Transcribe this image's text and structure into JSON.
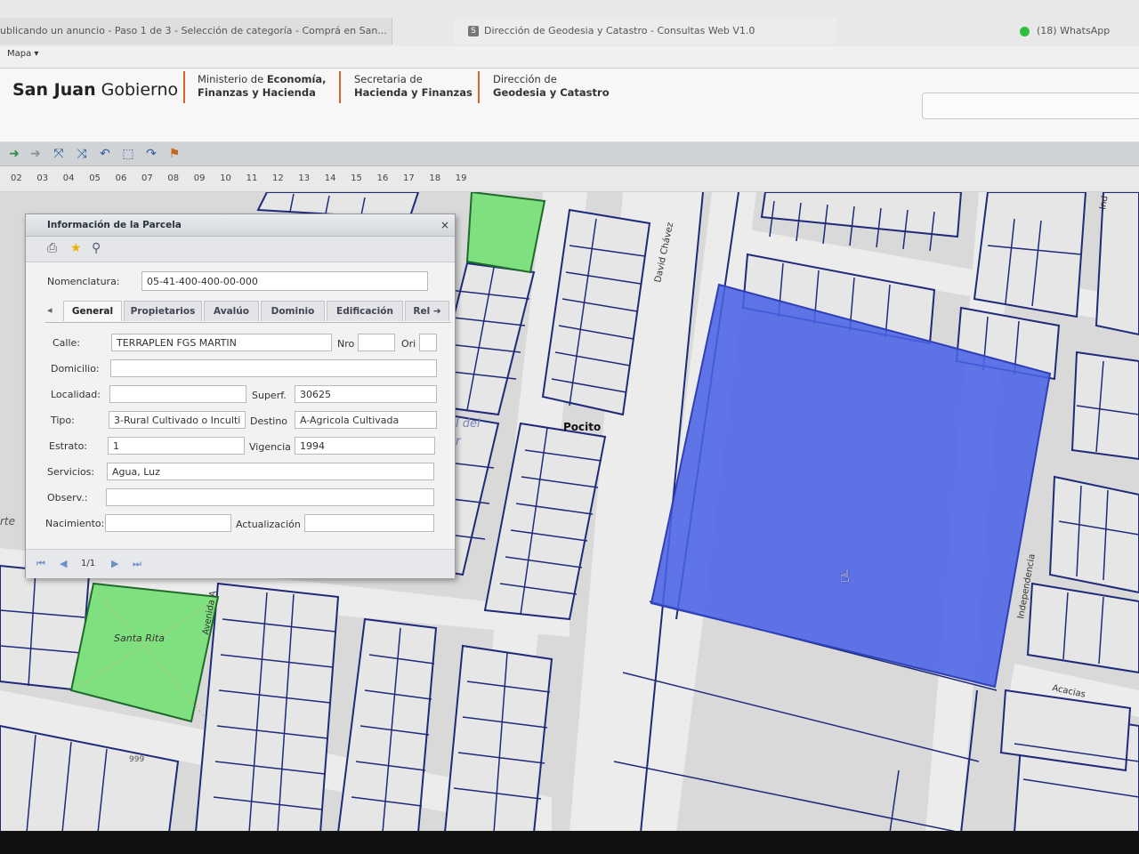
{
  "browser": {
    "tabs": [
      {
        "label": "ublicando un anuncio - Paso 1 de 3 - Selección de categoría - Comprá en San..."
      },
      {
        "label": "Dirección de Geodesia y Catastro - Consultas Web V1.0",
        "favicon": "S"
      },
      {
        "label": "(18) WhatsApp"
      }
    ]
  },
  "menu": {
    "mapa": "Mapa ▾"
  },
  "header": {
    "brand_bold": "San Juan",
    "brand_light": " Gobierno",
    "ministries": [
      {
        "line1_a": "Ministerio de ",
        "line1_b": "Economía,",
        "line2": "Finanzas y Hacienda"
      },
      {
        "line1_a": "Secretaria  de",
        "line1_b": "",
        "line2": "Hacienda y Finanzas"
      },
      {
        "line1_a": "Dirección de",
        "line1_b": "",
        "line2": "Geodesia y Catastro"
      }
    ]
  },
  "zoom_levels": [
    "02",
    "03",
    "04",
    "05",
    "06",
    "07",
    "08",
    "09",
    "10",
    "11",
    "12",
    "13",
    "14",
    "15",
    "16",
    "17",
    "18",
    "19"
  ],
  "map": {
    "labels": {
      "pocito": "Pocito",
      "santa_rita": "Santa Rita",
      "david_chavez": "David Chávez",
      "independencia": "Independencia",
      "acacias": "Acacias",
      "avenida": "Avenida A",
      "ind": "Ind",
      "num999": "999",
      "del": "l del",
      "r_mark": "r",
      "rte": "rte"
    },
    "colors": {
      "background": "#d9d9d9",
      "block_fill": "#e6e6e6",
      "lines": "#1f2a78",
      "selected_parcel": "#4b63e6",
      "park": "#7fe07f"
    }
  },
  "dialog": {
    "title": "Información de la Parcela",
    "close": "×",
    "nomenclatura_label": "Nomenclatura:",
    "nomenclatura_value": "05-41-400-400-00-000",
    "tabs": [
      {
        "label": "General",
        "active": true
      },
      {
        "label": "Propietarios"
      },
      {
        "label": "Avalúo"
      },
      {
        "label": "Dominio"
      },
      {
        "label": "Edificación"
      },
      {
        "label": "Rel ➔"
      }
    ],
    "fields": {
      "calle": {
        "label": "Calle:",
        "value": "TERRAPLEN FGS MARTIN"
      },
      "nro": {
        "label": "Nro",
        "value": ""
      },
      "ori": {
        "label": "Ori",
        "value": ""
      },
      "domicilio": {
        "label": "Domicilio:",
        "value": ""
      },
      "localidad": {
        "label": "Localidad:",
        "value": ""
      },
      "superf": {
        "label": "Superf.",
        "value": "30625"
      },
      "tipo": {
        "label": "Tipo:",
        "value": "3-Rural Cultivado o Inculti"
      },
      "destino": {
        "label": "Destino",
        "value": "A-Agricola Cultivada"
      },
      "estrato": {
        "label": "Estrato:",
        "value": "1"
      },
      "vigencia": {
        "label": "Vigencia",
        "value": "1994"
      },
      "servicios": {
        "label": "Servicios:",
        "value": "Agua, Luz"
      },
      "observ": {
        "label": "Observ.:",
        "value": ""
      },
      "nacimiento": {
        "label": "Nacimiento:",
        "value": ""
      },
      "actualizacion": {
        "label": "Actualización",
        "value": ""
      }
    },
    "pager": {
      "label": "1/1"
    }
  }
}
